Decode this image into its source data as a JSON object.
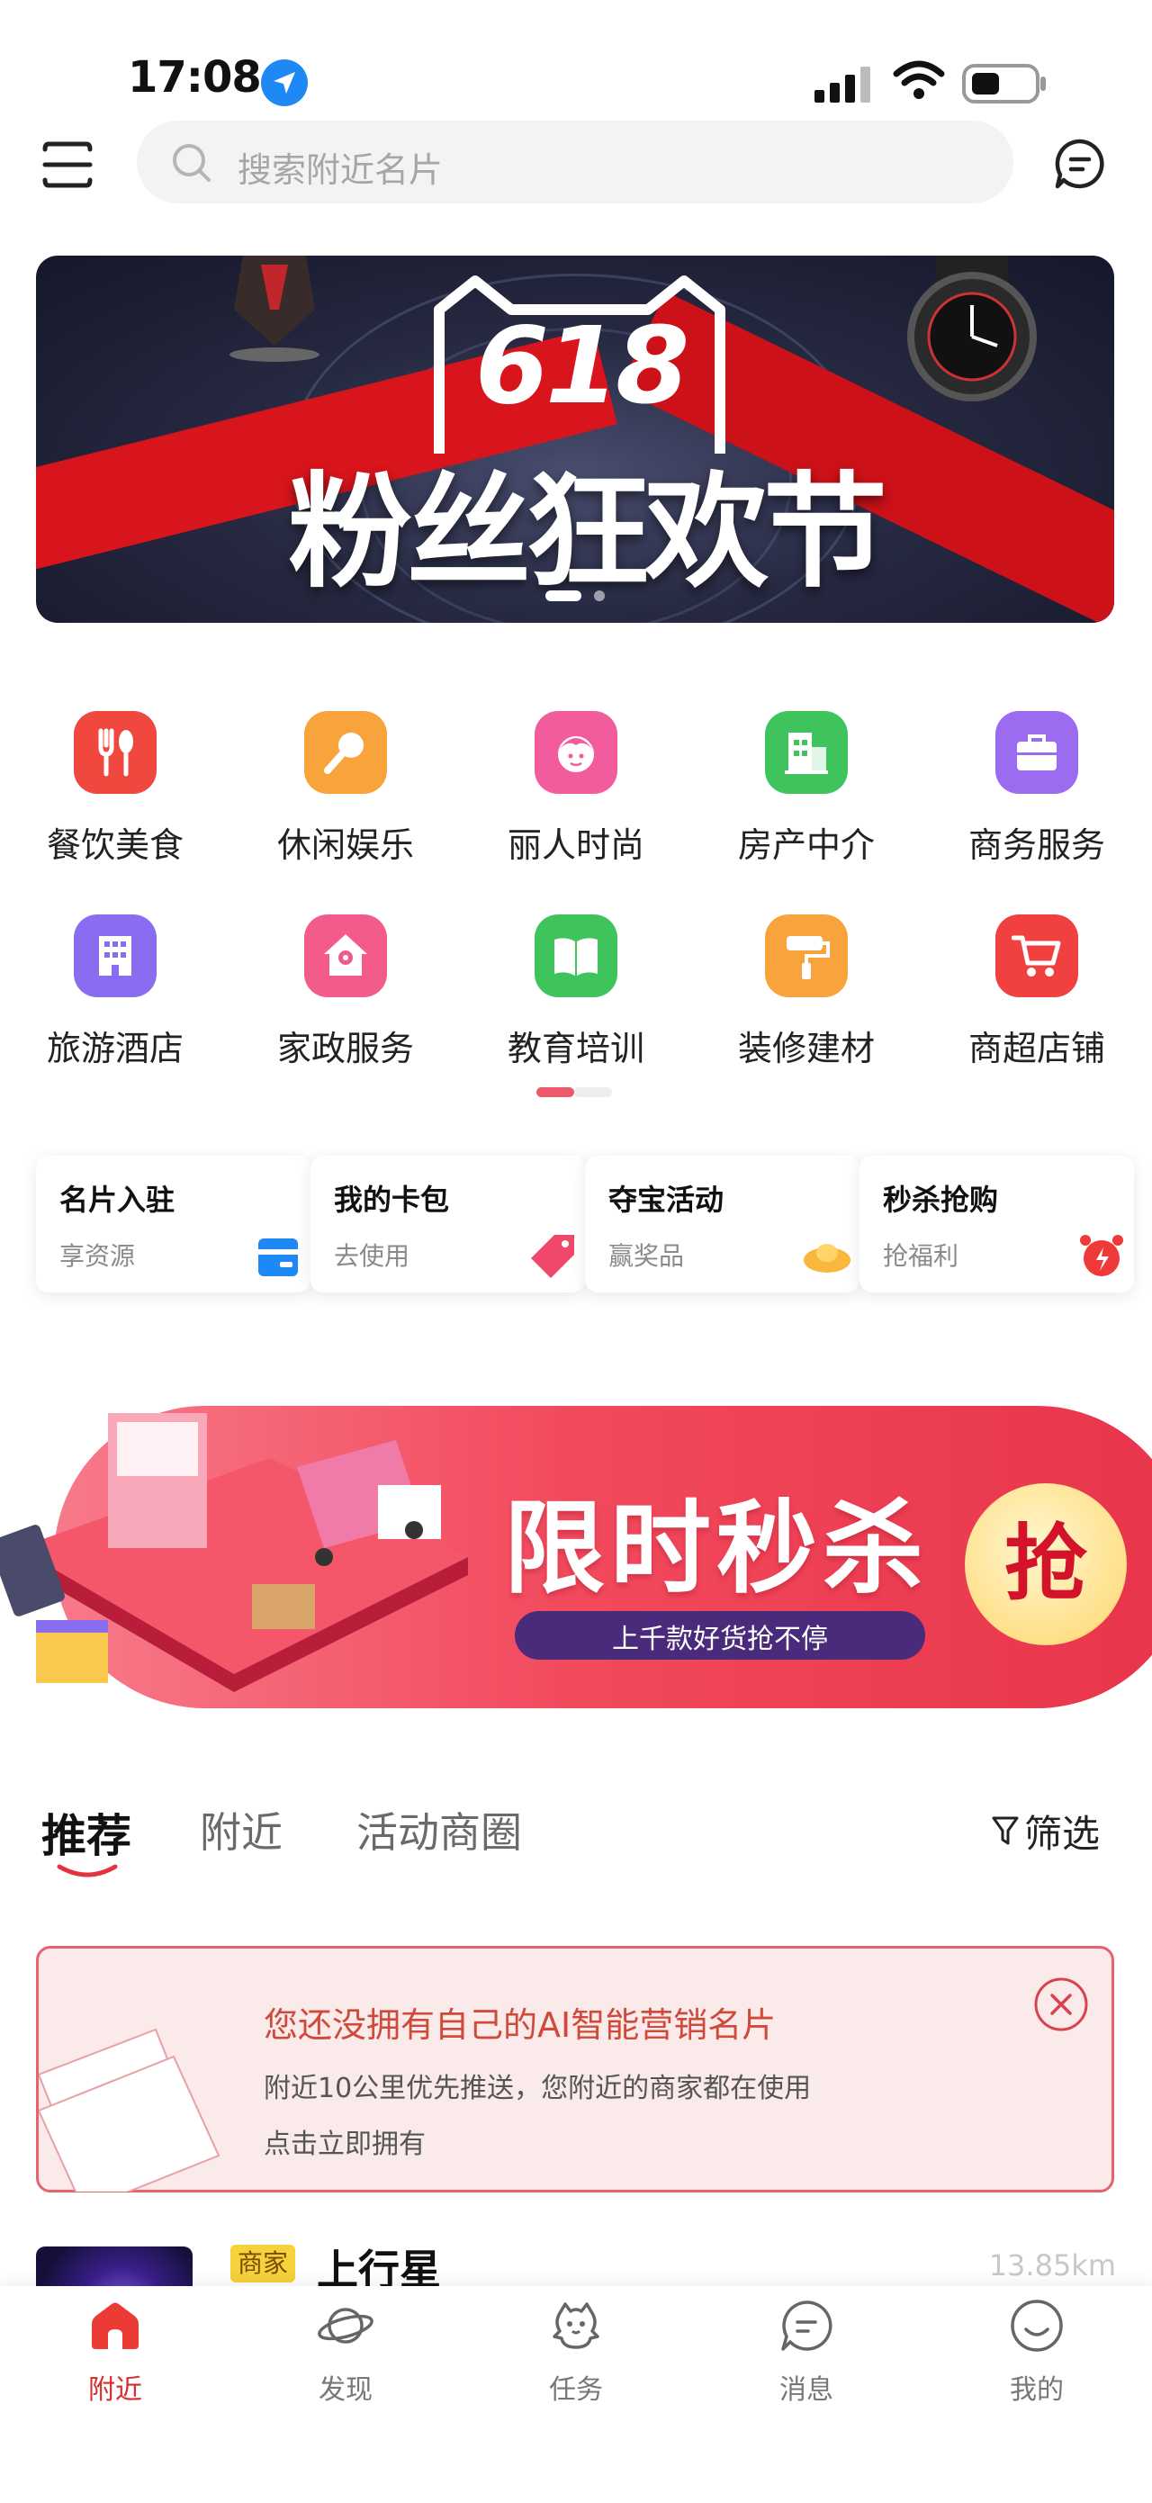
{
  "status_bar": {
    "time": "17:08"
  },
  "search": {
    "placeholder": "搜索附近名片"
  },
  "banner": {
    "number": "618",
    "title": "粉丝狂欢节"
  },
  "categories": [
    {
      "label": "餐饮美食",
      "icon": "fork-spoon-icon",
      "color": "#f0483f"
    },
    {
      "label": "休闲娱乐",
      "icon": "microphone-icon",
      "color": "#f9a33c"
    },
    {
      "label": "丽人时尚",
      "icon": "lady-face-icon",
      "color": "#f25b9c"
    },
    {
      "label": "房产中介",
      "icon": "building-icon",
      "color": "#3fc45d"
    },
    {
      "label": "商务服务",
      "icon": "briefcase-icon",
      "color": "#9b6cf0"
    },
    {
      "label": "旅游酒店",
      "icon": "hotel-icon",
      "color": "#8a6cf0"
    },
    {
      "label": "家政服务",
      "icon": "home-service-icon",
      "color": "#f25b8a"
    },
    {
      "label": "教育培训",
      "icon": "book-icon",
      "color": "#3fc45d"
    },
    {
      "label": "装修建材",
      "icon": "paint-roller-icon",
      "color": "#f9a33c"
    },
    {
      "label": "商超店铺",
      "icon": "shopping-cart-icon",
      "color": "#f0403f"
    }
  ],
  "quick_cards": [
    {
      "title": "名片入驻",
      "sub": "享资源",
      "icon": "card-icon",
      "color": "#1e88f5"
    },
    {
      "title": "我的卡包",
      "sub": "去使用",
      "icon": "tag-icon",
      "color": "#f0486a"
    },
    {
      "title": "夺宝活动",
      "sub": "赢奖品",
      "icon": "gold-ingot-icon",
      "color": "#f9b83c"
    },
    {
      "title": "秒杀抢购",
      "sub": "抢福利",
      "icon": "alarm-clock-icon",
      "color": "#f03a3a"
    }
  ],
  "promo": {
    "title": "限时秒杀",
    "sub": "上千款好货抢不停",
    "grab": "抢"
  },
  "tabs": [
    {
      "label": "推荐",
      "active": true
    },
    {
      "label": "附近",
      "active": false
    },
    {
      "label": "活动商圈",
      "active": false
    }
  ],
  "filter": {
    "label": "筛选"
  },
  "notice": {
    "title": "您还没拥有自己的AI智能营销名片",
    "line1": "附近10公里优先推送，您附近的商家都在使用",
    "line2": "点击立即拥有"
  },
  "list": [
    {
      "badge": "商家",
      "name": "上行星",
      "distance": "13.85km"
    }
  ],
  "bottom_nav": [
    {
      "label": "附近",
      "icon": "home-icon",
      "active": true
    },
    {
      "label": "发现",
      "icon": "planet-icon",
      "active": false
    },
    {
      "label": "任务",
      "icon": "mascot-icon",
      "active": false
    },
    {
      "label": "消息",
      "icon": "chat-bubble-icon",
      "active": false
    },
    {
      "label": "我的",
      "icon": "smiley-icon",
      "active": false
    }
  ]
}
